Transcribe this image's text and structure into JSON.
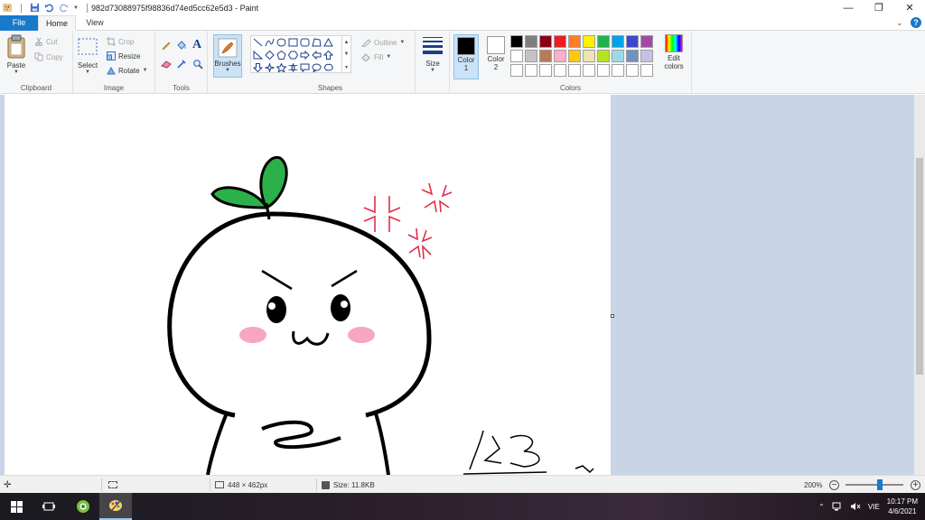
{
  "window": {
    "title": "982d73088975f98836d74ed5cc62e5d3 - Paint",
    "controls": {
      "minimize": "—",
      "maximize": "❐",
      "close": "✕"
    }
  },
  "tabs": [
    {
      "label": "File"
    },
    {
      "label": "Home"
    },
    {
      "label": "View"
    }
  ],
  "help": "?",
  "ribbon": {
    "clipboard": {
      "label": "Clipboard",
      "paste": "Paste",
      "cut": "Cut",
      "copy": "Copy"
    },
    "image": {
      "label": "Image",
      "select": "Select",
      "crop": "Crop",
      "resize": "Resize",
      "rotate": "Rotate"
    },
    "tools": {
      "label": "Tools",
      "text_glyph": "A"
    },
    "brushes": {
      "label": "Brushes"
    },
    "shapes": {
      "label": "Shapes",
      "outline": "Outline",
      "fill": "Fill"
    },
    "size": {
      "label": "Size"
    },
    "colors": {
      "label": "Colors",
      "color1": "Color 1",
      "color2": "Color 2",
      "edit_colors": "Edit colors",
      "color1_value": "#000000",
      "color2_value": "#ffffff",
      "palette": [
        "#000000",
        "#7f7f7f",
        "#880015",
        "#ed1c24",
        "#ff7f27",
        "#fff200",
        "#22b14c",
        "#00a2e8",
        "#3f48cc",
        "#a349a4",
        "#ffffff",
        "#c3c3c3",
        "#b97a57",
        "#ffaec9",
        "#ffc90e",
        "#efe4b0",
        "#b5e61d",
        "#99d9ea",
        "#7092be",
        "#c8bfe7",
        "#ffffff",
        "#ffffff",
        "#ffffff",
        "#ffffff",
        "#ffffff",
        "#ffffff",
        "#ffffff",
        "#ffffff",
        "#ffffff",
        "#ffffff"
      ]
    }
  },
  "status": {
    "dimensions": "448 × 462px",
    "size": "Size: 11.8KB",
    "zoom": "200%",
    "zoom_level": 0.6
  },
  "taskbar": {
    "tray_lang": "VIE",
    "time": "10:17 PM",
    "date": "4/6/2021"
  }
}
